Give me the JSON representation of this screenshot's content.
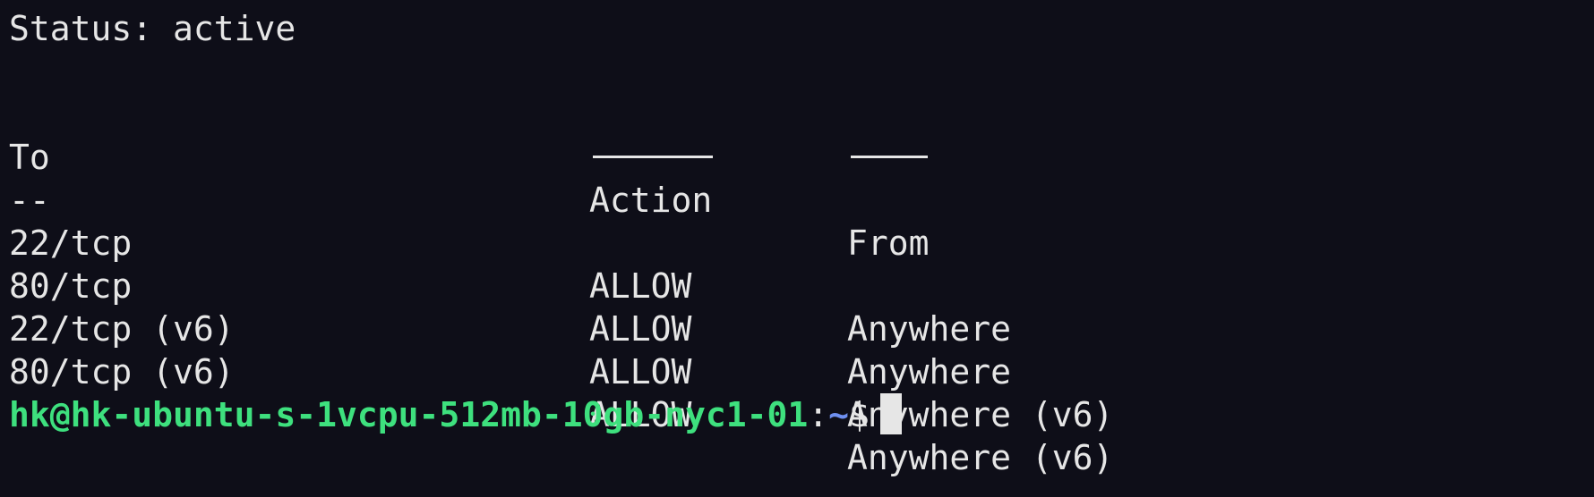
{
  "terminal": {
    "status_line": "Status: active",
    "table": {
      "headers": {
        "to": "To",
        "action": "Action",
        "from": "From"
      },
      "to_separator": "--",
      "rows": [
        {
          "to": "22/tcp",
          "action": "ALLOW",
          "from": "Anywhere"
        },
        {
          "to": "80/tcp",
          "action": "ALLOW",
          "from": "Anywhere"
        },
        {
          "to": "22/tcp (v6)",
          "action": "ALLOW",
          "from": "Anywhere (v6)"
        },
        {
          "to": "80/tcp (v6)",
          "action": "ALLOW",
          "from": "Anywhere (v6)"
        }
      ]
    },
    "prompt": {
      "user_host": "hk@hk-ubuntu-s-1vcpu-512mb-10gb-nyc1-01",
      "separator": ":",
      "path": "~",
      "symbol": "$"
    },
    "colors": {
      "background": "#0e0e18",
      "text": "#e6e6e6",
      "prompt_user": "#3ee07e",
      "prompt_path": "#6e8ff0"
    }
  }
}
